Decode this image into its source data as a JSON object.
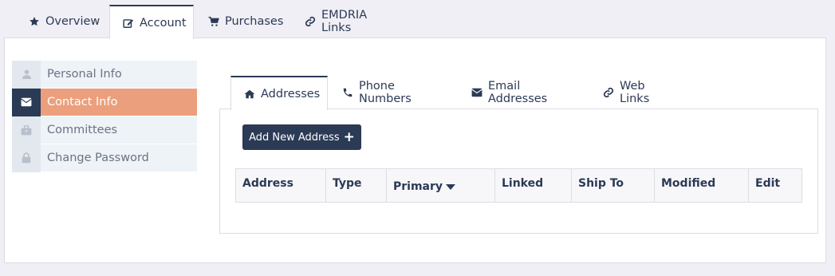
{
  "top_tabs": [
    {
      "label": "Overview",
      "icon": "star-icon"
    },
    {
      "label": "Account",
      "icon": "edit-icon",
      "active": true
    },
    {
      "label": "Purchases",
      "icon": "cart-icon"
    },
    {
      "label": "EMDRIA Links",
      "icon": "link-icon"
    }
  ],
  "side_nav": [
    {
      "label": "Personal Info",
      "icon": "user-icon"
    },
    {
      "label": "Contact Info",
      "icon": "envelope-icon",
      "active": true
    },
    {
      "label": "Committees",
      "icon": "briefcase-icon"
    },
    {
      "label": "Change Password",
      "icon": "lock-icon"
    }
  ],
  "inner_tabs": [
    {
      "label": "Addresses",
      "icon": "home-icon",
      "active": true
    },
    {
      "label": "Phone Numbers",
      "icon": "phone-icon"
    },
    {
      "label": "Email Addresses",
      "icon": "envelope-icon"
    },
    {
      "label": "Web Links",
      "icon": "link-icon"
    }
  ],
  "add_button": {
    "label": "Add New Address"
  },
  "table": {
    "columns": [
      "Address",
      "Type",
      "Primary",
      "Linked",
      "Ship To",
      "Modified",
      "Edit"
    ],
    "sorted_column": "Primary"
  },
  "colors": {
    "primary": "#2b3a55",
    "accent": "#ec9f7c",
    "side_bg": "#eef3f8"
  }
}
